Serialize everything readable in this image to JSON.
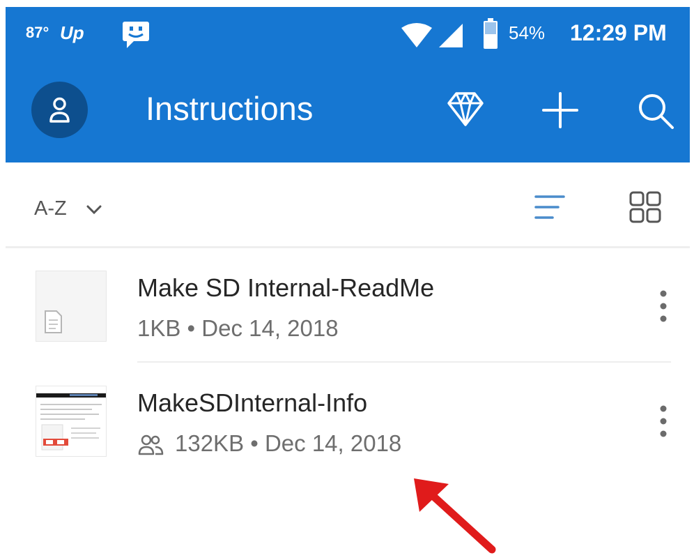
{
  "status_bar": {
    "temperature": "87°",
    "carrier": "Up",
    "battery": "54%",
    "time": "12:29 PM",
    "icons": [
      "message-icon",
      "wifi-icon",
      "signal-icon",
      "battery-icon"
    ]
  },
  "toolbar": {
    "title": "Instructions",
    "actions": [
      "diamond-icon",
      "plus-icon",
      "search-icon"
    ]
  },
  "sort_bar": {
    "sort_label": "A-Z",
    "view_options": [
      "list-view-icon",
      "grid-view-icon"
    ]
  },
  "files": [
    {
      "name": "Make SD Internal-ReadMe",
      "meta": "1KB • Dec 14, 2018",
      "shared": false,
      "thumbnail": "document-icon"
    },
    {
      "name": "MakeSDInternal-Info",
      "meta": "132KB • Dec 14, 2018",
      "shared": true,
      "thumbnail": "screenshot-preview"
    }
  ],
  "colors": {
    "app_bar": "#1677d2",
    "avatar": "#0d4f8e",
    "accent": "#4a8ccb",
    "annotation_arrow": "#e01b1b"
  }
}
